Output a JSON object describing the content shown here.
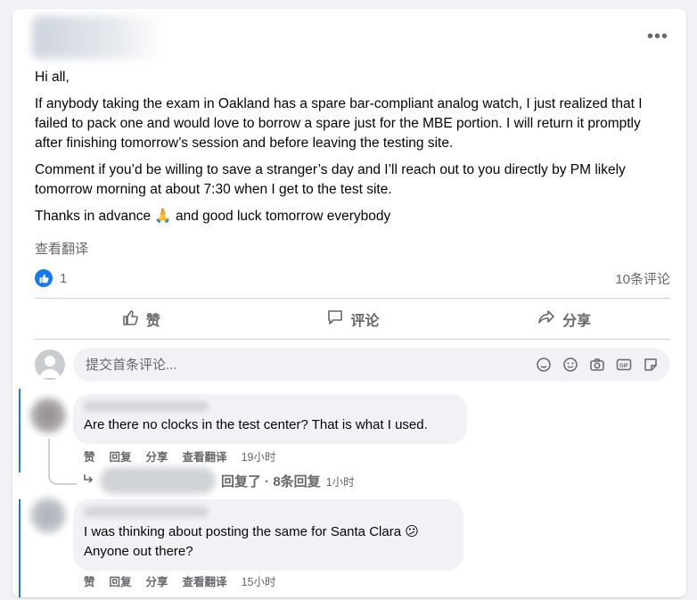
{
  "post": {
    "paragraphs": [
      "Hi all,",
      "If anybody taking the exam in Oakland has a spare bar-compliant analog watch, I just realized that I failed to pack one and would love to borrow a spare just for the MBE portion. I will return it promptly after finishing tomorrow’s session and before leaving the testing site.",
      "Comment if you’d be willing to save a stranger’s day and I’ll reach out to you directly by PM likely tomorrow morning at about 7:30 when I get to the test site.",
      "Thanks in advance 🙏 and good luck tomorrow everybody"
    ],
    "see_translation": "查看翻译",
    "more_icon": "•••"
  },
  "stats": {
    "reaction_count": "1",
    "comment_count": "10条评论"
  },
  "actions": {
    "like": "赞",
    "comment": "评论",
    "share": "分享"
  },
  "composer": {
    "placeholder": "提交首条评论..."
  },
  "comments": [
    {
      "text": "Are there no clocks in the test center? That is what I used.",
      "like": "赞",
      "reply": "回复",
      "share": "分享",
      "translate": "查看翻译",
      "time": "19小时"
    },
    {
      "text_line1": "I was thinking about posting the same for Santa Clara 😕",
      "text_line2": "Anyone out there?",
      "like": "赞",
      "reply": "回复",
      "share": "分享",
      "translate": "查看翻译",
      "time": "15小时"
    }
  ],
  "replies": {
    "label": "回复了 · 8条回复",
    "time": "1小时"
  },
  "colors": {
    "accent": "#1877f2",
    "secondary_text": "#65676b",
    "bubble": "#f0f2f5"
  }
}
